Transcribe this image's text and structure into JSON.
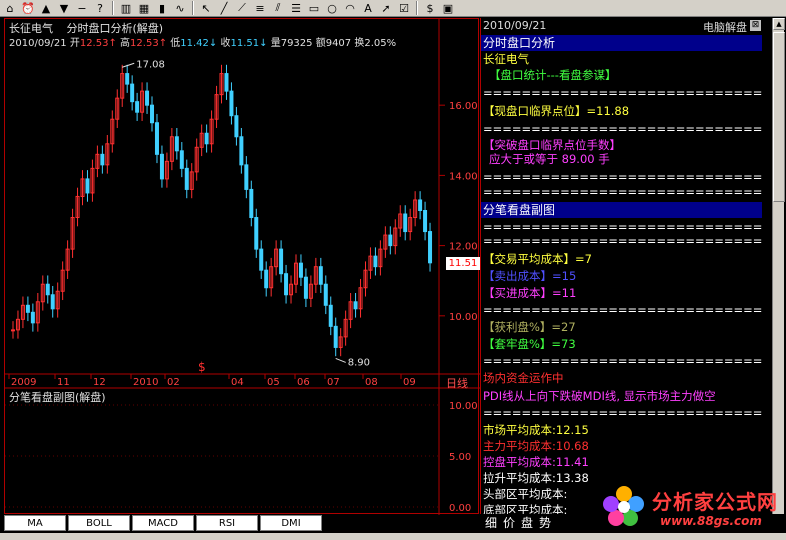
{
  "toolbar": {
    "icons": [
      "home-icon",
      "alarm-icon",
      "arrow-up-icon",
      "arrow-down-icon",
      "minus-icon",
      "help-icon",
      "chart-icon",
      "grid-icon",
      "candle-icon",
      "curve-icon",
      "cursor-icon",
      "line-draw-icon",
      "ray-icon",
      "text-lines-icon",
      "channel-icon",
      "fib-icon",
      "rect-icon",
      "circle-icon",
      "arc-icon",
      "text-icon",
      "arrow-icon",
      "checkbox-icon",
      "dollar-icon",
      "save-icon"
    ]
  },
  "chart": {
    "stock_name": "长征电气",
    "indicator_name": "分时盘口分析(解盘)",
    "quote": {
      "date": "2010/09/21",
      "open_label": "开",
      "open": "12.53",
      "open_arrow": "↑",
      "high_label": "高",
      "high": "12.53",
      "high_arrow": "↑",
      "low_label": "低",
      "low": "11.42",
      "low_arrow": "↓",
      "close_label": "收",
      "close": "11.51",
      "close_arrow": "↓",
      "vol_label": "量",
      "vol": "79325",
      "amount_label": "额",
      "amount": "9407",
      "turnover_label": "换",
      "turnover": "2.05%"
    },
    "y_ticks": [
      "16.00",
      "14.00",
      "12.00",
      "10.00"
    ],
    "peak_label": "17.08",
    "trough_label": "8.90",
    "current_price": "11.51",
    "dollar_mark": "$",
    "x_labels": [
      "2009",
      "11",
      "12",
      "2010",
      "02",
      "04",
      "05",
      "06",
      "07",
      "08",
      "09"
    ],
    "period_label": "日线",
    "sub_title": "分笔看盘副图(解盘)",
    "sub_ticks": [
      "10.00",
      "5.00",
      "0.00"
    ]
  },
  "chart_data": {
    "type": "candlestick",
    "title": "长征电气",
    "xlabel": "",
    "ylabel": "",
    "ylim": [
      8.4,
      17.6
    ],
    "x": [
      "2009",
      "11",
      "12",
      "2010",
      "02",
      "04",
      "05",
      "06",
      "07",
      "08",
      "09"
    ],
    "peak": 17.08,
    "trough": 8.9,
    "last_close": 11.51,
    "close_series": [
      9.6,
      9.9,
      10.3,
      10.1,
      9.8,
      10.4,
      10.9,
      10.6,
      10.2,
      10.7,
      11.3,
      11.9,
      12.8,
      13.4,
      13.9,
      13.5,
      14.2,
      14.6,
      14.3,
      14.9,
      15.6,
      16.2,
      16.9,
      16.6,
      16.1,
      15.8,
      16.4,
      16.0,
      15.5,
      14.6,
      13.9,
      14.4,
      15.1,
      14.7,
      14.2,
      13.6,
      14.1,
      14.8,
      15.2,
      14.9,
      15.6,
      16.3,
      16.9,
      16.4,
      15.7,
      15.1,
      14.3,
      13.6,
      12.8,
      11.9,
      11.3,
      10.8,
      11.4,
      11.9,
      11.2,
      10.6,
      10.9,
      11.5,
      11.1,
      10.5,
      10.9,
      11.4,
      10.9,
      10.3,
      9.7,
      9.1,
      9.4,
      9.9,
      10.4,
      10.2,
      10.8,
      11.3,
      11.7,
      11.4,
      11.9,
      12.3,
      12.0,
      12.5,
      12.9,
      12.4,
      12.8,
      13.3,
      13.0,
      12.4,
      11.51
    ]
  },
  "info": {
    "date": "2010/09/21",
    "brand": "电脑解盘",
    "close_glyph": "⊠",
    "section1_title": "分时盘口分析",
    "stock_name": "长征电气",
    "pankou_title": "【盘口统计---看盘参谋】",
    "sep": "================================",
    "critical_label": "【现盘口临界点位】=11.88",
    "break_label": "【突破盘口临界点位手数】",
    "break_value": "应大于或等于 89.00 手",
    "section2_title": "分笔看盘副图",
    "trade_cost": "【交易平均成本】=7",
    "sell_cost": "【卖出成本】=15",
    "buy_cost": "【买进成本】=11",
    "profit_pct": "【获利盘%】=27",
    "trapped_pct": "【套牢盘%】=73",
    "fund_title": "场内资金运作中",
    "pdi_text": "PDI线从上向下跌破MDI线, 显示市场主力做空",
    "market_cost": "市场平均成本:12.15",
    "main_cost": "主力平均成本:10.68",
    "control_cost": "控盘平均成本:11.41",
    "pull_cost": "拉升平均成本:13.38",
    "head_cost": "头部区平均成本:",
    "bottom_cost": "底部区平均成本:"
  },
  "tabs": [
    "MA",
    "BOLL",
    "MACD",
    "RSI",
    "DMI"
  ],
  "info_tabs": [
    "细",
    "价",
    "盘",
    "势"
  ],
  "watermark": {
    "text": "分析家公式网",
    "url": "www.88gs.com"
  }
}
